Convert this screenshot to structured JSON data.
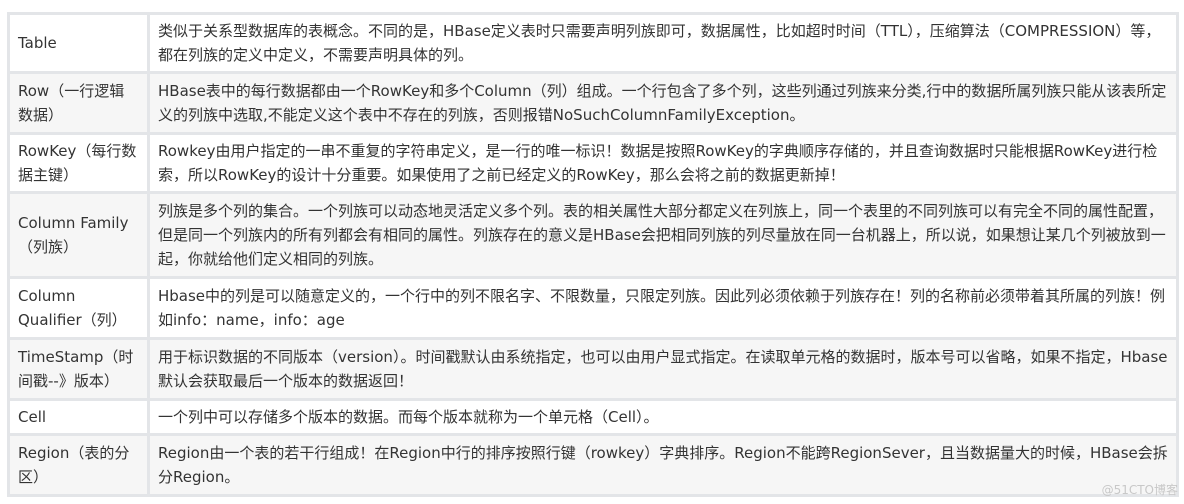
{
  "rows": [
    {
      "term": "Table",
      "desc": "类似于关系型数据库的表概念。不同的是，HBase定义表时只需要声明列族即可，数据属性，比如超时时间（TTL），压缩算法（COMPRESSION）等，都在列族的定义中定义，不需要声明具体的列。"
    },
    {
      "term": "Row（一行逻辑数据）",
      "desc": "HBase表中的每行数据都由一个RowKey和多个Column（列）组成。一个行包含了多个列，这些列通过列族来分类,行中的数据所属列族只能从该表所定义的列族中选取,不能定义这个表中不存在的列族，否则报错NoSuchColumnFamilyException。"
    },
    {
      "term": "RowKey（每行数据主键）",
      "desc": "Rowkey由用户指定的一串不重复的字符串定义，是一行的唯一标识！数据是按照RowKey的字典顺序存储的，并且查询数据时只能根据RowKey进行检索，所以RowKey的设计十分重要。如果使用了之前已经定义的RowKey，那么会将之前的数据更新掉！"
    },
    {
      "term": "Column Family（列族）",
      "desc": "列族是多个列的集合。一个列族可以动态地灵活定义多个列。表的相关属性大部分都定义在列族上，同一个表里的不同列族可以有完全不同的属性配置，但是同一个列族内的所有列都会有相同的属性。列族存在的意义是HBase会把相同列族的列尽量放在同一台机器上，所以说，如果想让某几个列被放到一起，你就给他们定义相同的列族。"
    },
    {
      "term": "Column Qualifier（列）",
      "desc": "Hbase中的列是可以随意定义的，一个行中的列不限名字、不限数量，只限定列族。因此列必须依赖于列族存在！列的名称前必须带着其所属的列族！例如info：name，info：age"
    },
    {
      "term": "TimeStamp（时间戳--》版本）",
      "desc": "用于标识数据的不同版本（version）。时间戳默认由系统指定，也可以由用户显式指定。在读取单元格的数据时，版本号可以省略，如果不指定，Hbase默认会获取最后一个版本的数据返回！"
    },
    {
      "term": "Cell",
      "desc": "一个列中可以存储多个版本的数据。而每个版本就称为一个单元格（Cell）。"
    },
    {
      "term": "Region（表的分区）",
      "desc": "Region由一个表的若干行组成！在Region中行的排序按照行键（rowkey）字典排序。Region不能跨RegionSever，且当数据量大的时候，HBase会拆分Region。"
    }
  ],
  "watermark": "@51CTO博客"
}
